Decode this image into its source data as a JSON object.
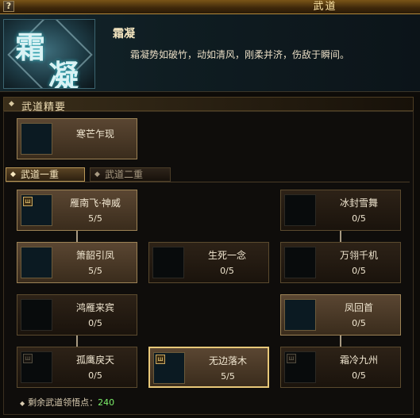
{
  "window": {
    "title": "武道",
    "help_label": "?"
  },
  "header": {
    "emblem_chars": [
      "霜",
      "凝"
    ],
    "skill_name": "霜凝",
    "skill_description": "霜凝势如破竹，动如清风，刚柔并济，伤敌于瞬间。"
  },
  "essence": {
    "section_title": "武道精要",
    "card": {
      "name": "寒芒乍现",
      "icon": "blade-icon"
    }
  },
  "tabs": [
    {
      "label": "武道一重",
      "active": true
    },
    {
      "label": "武道二重",
      "active": false
    }
  ],
  "skills": [
    {
      "name": "雁南飞·神威",
      "level": "5/5",
      "icon": "wind-icon"
    },
    {
      "name": "冰封雪舞",
      "level": "0/5",
      "icon": "ice-icon"
    },
    {
      "name": "箫韶引凤",
      "level": "5/5",
      "icon": "moon-icon"
    },
    {
      "name": "生死一念",
      "level": "0/5",
      "icon": "leaf-icon"
    },
    {
      "name": "万翎千机",
      "level": "0/5",
      "icon": "orb-icon"
    },
    {
      "name": "鸿雁来宾",
      "level": "0/5",
      "icon": "feather-icon"
    },
    {
      "name": "凤回首",
      "level": "0/5",
      "icon": "moon-icon"
    },
    {
      "name": "孤鹰戾天",
      "level": "0/5",
      "icon": "wind-icon"
    },
    {
      "name": "无边落木",
      "level": "5/5",
      "icon": "ice-icon"
    },
    {
      "name": "霜冷九州",
      "level": "0/5",
      "icon": "wind-icon"
    }
  ],
  "remaining": {
    "label": "剩余武道领悟点：",
    "value": "240"
  },
  "colors": {
    "accent_gold": "#e8c879",
    "points_green": "#7cf06a"
  }
}
